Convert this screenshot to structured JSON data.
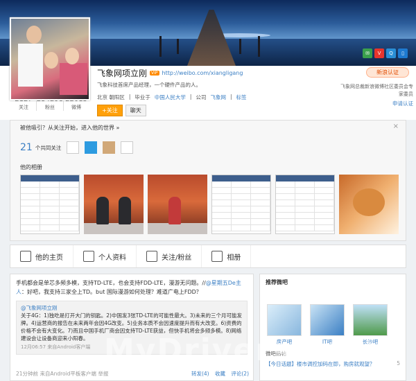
{
  "banner": {
    "icons": [
      "weibo-icon",
      "vip-icon",
      "qq-icon",
      "mobile-icon"
    ]
  },
  "profile": {
    "name": "飞象网项立刚",
    "badge": "VIP",
    "url": "http://weibo.com/xiangligang",
    "bio": "飞象科技首席产品经理，一个硬件产品的人。",
    "location": "北京 朝阳区",
    "school_label": "毕业于",
    "school": "中国人民大学",
    "company_label": "公司",
    "company": "飞象网",
    "tags": "标签",
    "stats": [
      {
        "num": "2127",
        "label": "关注"
      },
      {
        "num": "234298",
        "label": "粉丝"
      },
      {
        "num": "22015",
        "label": "微博"
      }
    ],
    "follow_label": "+关注",
    "chat_label": "聊天",
    "verify_label": "新浪认证",
    "verify_desc": "飞象网总裁新浪微博社区委员会专家委员",
    "verify_link": "申请认证"
  },
  "panel": {
    "title": "被他吸引？从关注开始，进入他的世界 »",
    "close": "×",
    "mutual_count": "21",
    "mutual_text": "个共同关注",
    "album_title": "他的相册"
  },
  "nav": {
    "tabs": [
      {
        "label": "他的主页",
        "icon": "home-icon"
      },
      {
        "label": "个人资料",
        "icon": "person-icon"
      },
      {
        "label": "关注/粉丝",
        "icon": "people-icon"
      },
      {
        "label": "相册",
        "icon": "camera-icon"
      }
    ]
  },
  "feed": {
    "text_a": "手机都会是单芯多频多模，支持TD-LTE，也会支持FDD-LTE，漫游无问题。//",
    "mention": "@星期五De主人",
    "text_b": "：好吧，我支持三家全上TD。but 国际漫游如何处理？难道广电上FDD？",
    "quote_name": "@飞象网项立刚",
    "quote_text": "关于4G：1)独吃是打开大门的钥匙。2)中国发3张TD-LTE的可能性最大。3)未来的三个月可能发牌。4)运营商的报告在未来两年会因4G改变。5)业务本质不会因速度提升而有大改变。6)资费的价格不会有大变化。7)而且中国手机厂商会因支持TD-LTE获益，但快手机将会多频多模。8)网络建设会让设备商迎来小阳春。",
    "quote_meta": "12月06:57 来自Android客户端",
    "time": "21分钟前",
    "source": "来自Android平板客户端",
    "report": "举报",
    "actions": [
      "转发(4)",
      "收藏",
      "评论(2)"
    ]
  },
  "side": {
    "title": "推荐微吧",
    "tiles": [
      {
        "label": "房产吧"
      },
      {
        "label": "IT吧"
      },
      {
        "label": "长沙吧"
      }
    ],
    "sub": "微吧热帖",
    "news": "【今日话题】楼市调控加码在即，购房就观望？",
    "news_count": "5"
  },
  "watermark": "MyDrivers.com"
}
